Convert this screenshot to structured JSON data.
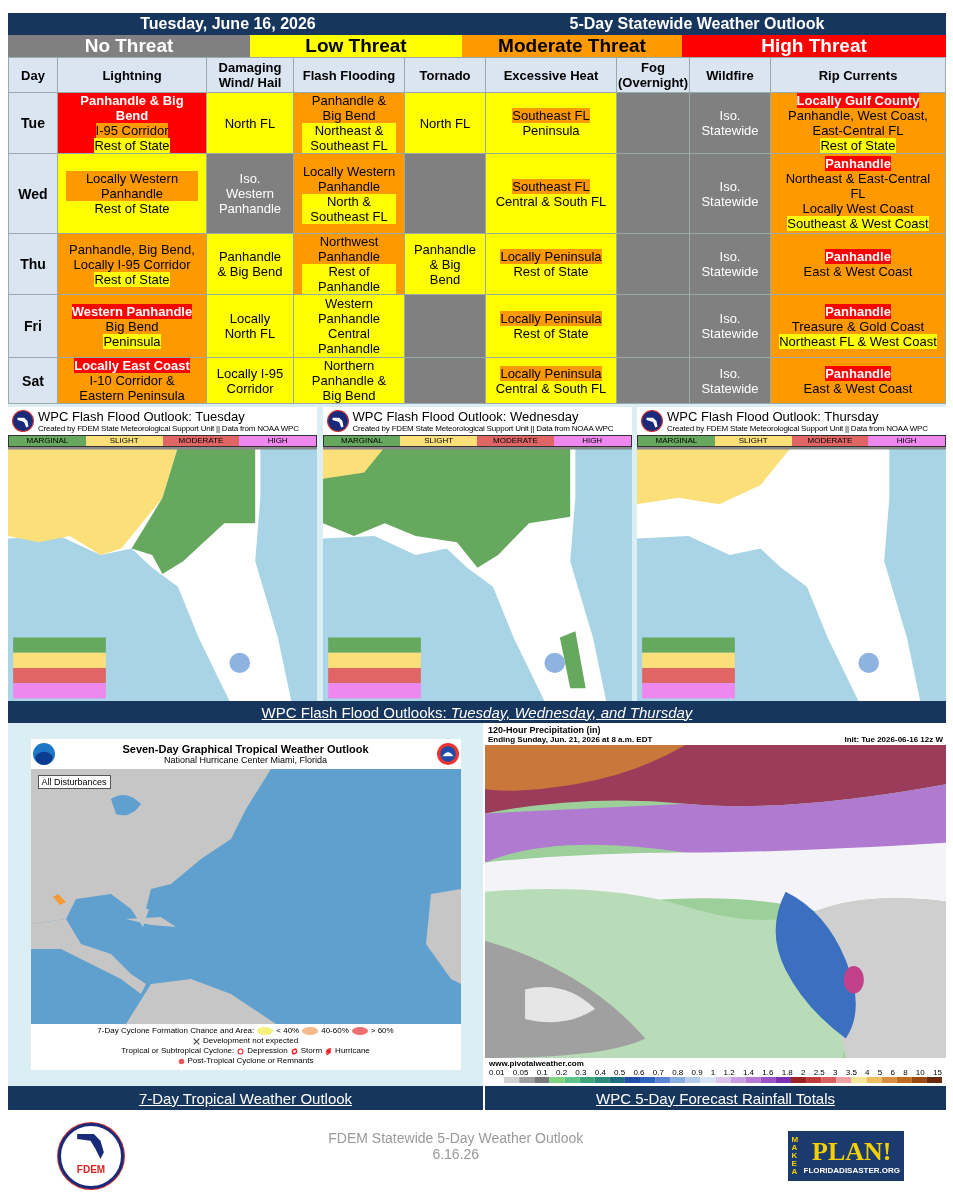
{
  "header": {
    "date": "Tuesday, June 16, 2026",
    "title": "5-Day Statewide Weather Outlook"
  },
  "threat_legend": [
    {
      "label": "No Threat",
      "color": "#808080"
    },
    {
      "label": "Low Threat",
      "color": "#ffff00"
    },
    {
      "label": "Moderate Threat",
      "color": "#ff9900"
    },
    {
      "label": "High Threat",
      "color": "#ff0000"
    }
  ],
  "table": {
    "columns": [
      "Day",
      "Lightning",
      "Damaging Wind/ Hail",
      "Flash Flooding",
      "Tornado",
      "Excessive Heat",
      "Fog (Overnight)",
      "Wildfire",
      "Rip Currents"
    ],
    "rows": [
      {
        "cells": [
          {
            "kind": "day",
            "text": "Tue"
          },
          {
            "kind": "threat",
            "color": "#ff0000",
            "lines": [
              {
                "text": "Panhandle & Big Bend",
                "color": "#ff0000"
              },
              {
                "text": "I-95 Corridor",
                "color": "#ff9900"
              },
              {
                "text": "Rest of State",
                "color": "#ffff00"
              }
            ]
          },
          {
            "kind": "threat",
            "color": "#ffff00",
            "lines": [
              {
                "text": "North FL",
                "color": "#ffff00"
              }
            ]
          },
          {
            "kind": "threat",
            "color": "#ff9900",
            "lines": [
              {
                "text": "Panhandle & Big Bend",
                "color": "#ff9900"
              },
              {
                "text": "Northeast & Southeast FL",
                "color": "#ffff00"
              }
            ]
          },
          {
            "kind": "threat",
            "color": "#ffff00",
            "lines": [
              {
                "text": "North FL",
                "color": "#ffff00"
              }
            ]
          },
          {
            "kind": "threat",
            "color": "#ffff00",
            "lines": [
              {
                "text": "Southeast FL",
                "color": "#ff9900"
              },
              {
                "text": "Peninsula",
                "color": "#ffff00"
              }
            ]
          },
          {
            "kind": "threat",
            "color": "#808080"
          },
          {
            "kind": "threat",
            "color": "#808080",
            "lines": [
              {
                "text": "Iso. Statewide"
              }
            ]
          },
          {
            "kind": "threat",
            "color": "#ff9900",
            "lines": [
              {
                "text": "Locally Gulf County",
                "color": "#ff0000"
              },
              {
                "text": "Panhandle, West Coast, East-Central FL",
                "color": "#ff9900"
              },
              {
                "text": "Rest of State",
                "color": "#ffff00"
              }
            ]
          }
        ]
      },
      {
        "cells": [
          {
            "kind": "day",
            "text": "Wed"
          },
          {
            "kind": "threat",
            "color": "#ffff00",
            "lines": [
              {
                "text": "Locally Western Panhandle",
                "color": "#ff9900"
              },
              {
                "text": "Rest of State",
                "color": "#ffff00"
              }
            ]
          },
          {
            "kind": "threat",
            "color": "#808080",
            "lines": [
              {
                "text": "Iso. Western Panhandle"
              }
            ]
          },
          {
            "kind": "threat",
            "color": "#ff9900",
            "lines": [
              {
                "text": "Locally Western Panhandle",
                "color": "#ff9900"
              },
              {
                "text": "North & Southeast FL",
                "color": "#ffff00"
              }
            ]
          },
          {
            "kind": "threat",
            "color": "#808080"
          },
          {
            "kind": "threat",
            "color": "#ffff00",
            "lines": [
              {
                "text": "Southeast FL",
                "color": "#ff9900"
              },
              {
                "text": "Central & South FL",
                "color": "#ffff00"
              }
            ]
          },
          {
            "kind": "threat",
            "color": "#808080"
          },
          {
            "kind": "threat",
            "color": "#808080",
            "lines": [
              {
                "text": "Iso. Statewide"
              }
            ]
          },
          {
            "kind": "threat",
            "color": "#ff9900",
            "lines": [
              {
                "text": "Panhandle",
                "color": "#ff0000"
              },
              {
                "text": "Northeast & East-Central FL",
                "color": "#ff9900"
              },
              {
                "text": "Locally West Coast",
                "color": "#ff9900"
              },
              {
                "text": "Southeast & West Coast",
                "color": "#ffff00"
              }
            ]
          }
        ]
      },
      {
        "cells": [
          {
            "kind": "day",
            "text": "Thu"
          },
          {
            "kind": "threat",
            "color": "#ff9900",
            "lines": [
              {
                "text": "Panhandle, Big Bend, Locally I-95 Corridor",
                "color": "#ff9900"
              },
              {
                "text": "Rest of State",
                "color": "#ffff00"
              }
            ]
          },
          {
            "kind": "threat",
            "color": "#ffff00",
            "lines": [
              {
                "text": "Panhandle & Big Bend",
                "color": "#ffff00"
              }
            ]
          },
          {
            "kind": "threat",
            "color": "#ff9900",
            "lines": [
              {
                "text": "Northwest Panhandle",
                "color": "#ff9900"
              },
              {
                "text": "Rest of Panhandle",
                "color": "#ffff00"
              }
            ]
          },
          {
            "kind": "threat",
            "color": "#ffff00",
            "lines": [
              {
                "text": "Panhandle & Big Bend",
                "color": "#ffff00"
              }
            ]
          },
          {
            "kind": "threat",
            "color": "#ffff00",
            "lines": [
              {
                "text": "Locally Peninsula",
                "color": "#ff9900"
              },
              {
                "text": "Rest of State",
                "color": "#ffff00"
              }
            ]
          },
          {
            "kind": "threat",
            "color": "#808080"
          },
          {
            "kind": "threat",
            "color": "#808080",
            "lines": [
              {
                "text": "Iso. Statewide"
              }
            ]
          },
          {
            "kind": "threat",
            "color": "#ff9900",
            "lines": [
              {
                "text": "Panhandle",
                "color": "#ff0000"
              },
              {
                "text": "East & West Coast",
                "color": "#ff9900"
              }
            ]
          }
        ]
      },
      {
        "cells": [
          {
            "kind": "day",
            "text": "Fri"
          },
          {
            "kind": "threat",
            "color": "#ff9900",
            "lines": [
              {
                "text": "Western Panhandle",
                "color": "#ff0000"
              },
              {
                "text": "Big Bend",
                "color": "#ff9900"
              },
              {
                "text": "Peninsula",
                "color": "#ffff00"
              }
            ]
          },
          {
            "kind": "threat",
            "color": "#ffff00",
            "lines": [
              {
                "text": "Locally North FL",
                "color": "#ffff00"
              }
            ]
          },
          {
            "kind": "threat",
            "color": "#ffff00",
            "lines": [
              {
                "text": "Western Panhandle",
                "color": "#ffff00"
              },
              {
                "text": "Central Panhandle",
                "color": "#ffff00"
              }
            ]
          },
          {
            "kind": "threat",
            "color": "#808080"
          },
          {
            "kind": "threat",
            "color": "#ffff00",
            "lines": [
              {
                "text": "Locally Peninsula",
                "color": "#ff9900"
              },
              {
                "text": "Rest of State",
                "color": "#ffff00"
              }
            ]
          },
          {
            "kind": "threat",
            "color": "#808080"
          },
          {
            "kind": "threat",
            "color": "#808080",
            "lines": [
              {
                "text": "Iso. Statewide"
              }
            ]
          },
          {
            "kind": "threat",
            "color": "#ff9900",
            "lines": [
              {
                "text": "Panhandle",
                "color": "#ff0000"
              },
              {
                "text": "Treasure & Gold Coast"
              },
              {
                "text": "Northeast FL & West Coast",
                "color": "#ffff00"
              }
            ]
          }
        ]
      },
      {
        "cells": [
          {
            "kind": "day",
            "text": "Sat"
          },
          {
            "kind": "threat",
            "color": "#ff9900",
            "lines": [
              {
                "text": "Locally East Coast",
                "color": "#ff0000"
              },
              {
                "text": "I-10 Corridor & Eastern Peninsula",
                "color": "#ff9900"
              }
            ]
          },
          {
            "kind": "threat",
            "color": "#ffff00",
            "lines": [
              {
                "text": "Locally I-95 Corridor",
                "color": "#ffff00"
              }
            ]
          },
          {
            "kind": "threat",
            "color": "#ffff00",
            "lines": [
              {
                "text": "Northern Panhandle & Big Bend",
                "color": "#ffff00"
              }
            ]
          },
          {
            "kind": "threat",
            "color": "#808080"
          },
          {
            "kind": "threat",
            "color": "#ffff00",
            "lines": [
              {
                "text": "Locally Peninsula",
                "color": "#ff9900"
              },
              {
                "text": "Central & South FL",
                "color": "#ffff00"
              }
            ]
          },
          {
            "kind": "threat",
            "color": "#808080"
          },
          {
            "kind": "threat",
            "color": "#808080",
            "lines": [
              {
                "text": "Iso. Statewide"
              }
            ]
          },
          {
            "kind": "threat",
            "color": "#ff9900",
            "lines": [
              {
                "text": "Panhandle",
                "color": "#ff0000"
              },
              {
                "text": "East & West Coast",
                "color": "#ff9900"
              }
            ]
          }
        ]
      }
    ]
  },
  "flood_outlooks": {
    "maps": [
      {
        "title": "WPC Flash Flood Outlook: Tuesday",
        "credit": "Created by FDEM State Meteorological Support Unit || Data from NOAA WPC",
        "categories": [
          "MARGINAL",
          "SLIGHT",
          "MODERATE",
          "HIGH"
        ]
      },
      {
        "title": "WPC Flash Flood Outlook: Wednesday",
        "credit": "Created by FDEM State Meteorological Support Unit || Data from NOAA WPC",
        "categories": [
          "MARGINAL",
          "SLIGHT",
          "MODERATE",
          "HIGH"
        ]
      },
      {
        "title": "WPC Flash Flood Outlook: Thursday",
        "credit": "Created by FDEM State Meteorological Support Unit || Data from NOAA WPC",
        "categories": [
          "MARGINAL",
          "SLIGHT",
          "MODERATE",
          "HIGH"
        ]
      }
    ],
    "caption": "WPC Flash Flood Outlooks: *Tuesday, Wednesday, and Thursday*"
  },
  "tropical": {
    "title": "Seven-Day Graphical Tropical Weather Outlook",
    "subtitle": "National Hurricane Center  Miami, Florida",
    "filter": "All Disturbances",
    "legend": {
      "chance_label": "7-Day Cyclone Formation Chance and Area:",
      "chances": [
        "< 40%",
        "40-60%",
        "> 60%"
      ],
      "not_expected": "Development not expected",
      "cyclone_label": "Tropical or Subtropical Cyclone:",
      "cyclones": [
        "Depression",
        "Storm",
        "Hurricane"
      ],
      "post_tropical": "Post-Tropical Cyclone or Remnants"
    },
    "caption": "7-Day Tropical Weather Outlook"
  },
  "rainfall": {
    "title": "120-Hour Precipitation (in)",
    "subtitle": "Ending Sunday, Jun. 21, 2026 at 8 a.m. EDT",
    "init": "Init: Tue 2026-06-16 12z W",
    "source": "www.pivotalweather.com",
    "scale": [
      "0.01",
      "0.05",
      "0.1",
      "0.2",
      "0.3",
      "0.4",
      "0.5",
      "0.6",
      "0.7",
      "0.8",
      "0.9",
      "1",
      "1.2",
      "1.4",
      "1.6",
      "1.8",
      "2",
      "2.5",
      "3",
      "3.5",
      "4",
      "5",
      "6",
      "8",
      "10",
      "15"
    ],
    "caption": "WPC 5-Day Forecast Rainfall Totals"
  },
  "footer": {
    "logo": "FDEM",
    "title": "FDEM Statewide 5-Day Weather Outlook",
    "date": "6.16.26",
    "plan_logo": {
      "top": "MAKE A",
      "main": "PLAN!",
      "site": "FLORIDADISASTER.ORG"
    }
  }
}
